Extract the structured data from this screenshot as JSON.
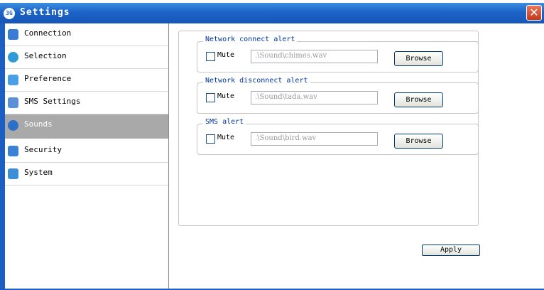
{
  "window": {
    "title": "Settings",
    "app_icon": "3G",
    "close_label": "✕"
  },
  "sidebar": {
    "items": [
      {
        "label": "Connection",
        "icon": "connection-icon",
        "color": "#3a7bd5"
      },
      {
        "label": "Selection",
        "icon": "selection-icon",
        "color": "#2f9bd6"
      },
      {
        "label": "Preference",
        "icon": "preference-icon",
        "color": "#4aa0e6"
      },
      {
        "label": "SMS Settings",
        "icon": "sms-icon",
        "color": "#5b8fd8"
      },
      {
        "label": "Sounds",
        "icon": "sounds-icon",
        "color": "#2c6fc9",
        "active": true
      },
      {
        "label": "Security",
        "icon": "lock-icon",
        "color": "#3b82d6"
      },
      {
        "label": "System",
        "icon": "system-icon",
        "color": "#3c8ed9"
      }
    ]
  },
  "sounds": {
    "mute_label": "Mute",
    "browse_label": "Browse",
    "alerts": [
      {
        "title": "Network connect alert",
        "path": ".\\Sound\\chimes.wav",
        "muted": false
      },
      {
        "title": "Network disconnect alert",
        "path": ".\\Sound\\tada.wav",
        "muted": false
      },
      {
        "title": "SMS alert",
        "path": ".\\Sound\\bird.wav",
        "muted": false
      }
    ]
  },
  "apply_label": "Apply",
  "colors": {
    "titlebar": "#1c63c7",
    "group_title": "#003399",
    "active_nav": "#a9a9a9"
  }
}
